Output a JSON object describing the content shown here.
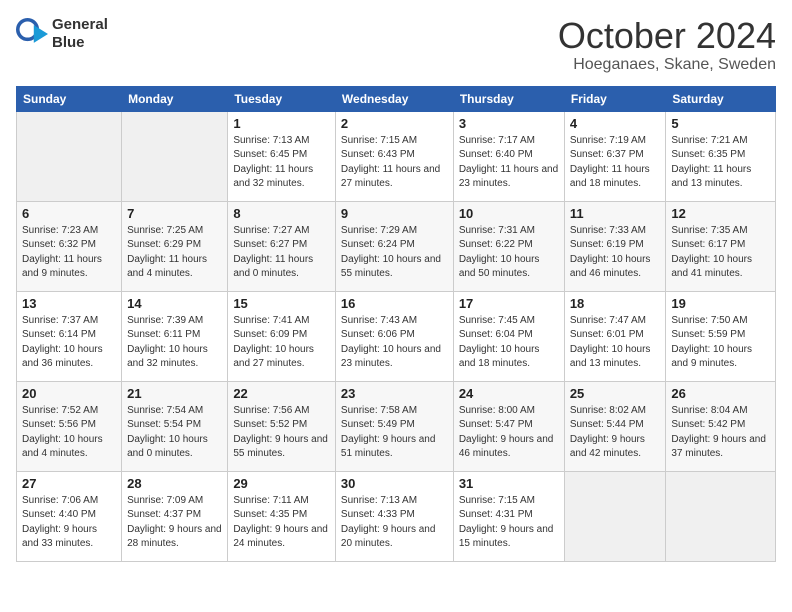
{
  "logo": {
    "line1": "General",
    "line2": "Blue"
  },
  "title": "October 2024",
  "location": "Hoeganaes, Skane, Sweden",
  "weekdays": [
    "Sunday",
    "Monday",
    "Tuesday",
    "Wednesday",
    "Thursday",
    "Friday",
    "Saturday"
  ],
  "weeks": [
    [
      {
        "day": "",
        "empty": true
      },
      {
        "day": "",
        "empty": true
      },
      {
        "day": "1",
        "sunrise": "Sunrise: 7:13 AM",
        "sunset": "Sunset: 6:45 PM",
        "daylight": "Daylight: 11 hours and 32 minutes."
      },
      {
        "day": "2",
        "sunrise": "Sunrise: 7:15 AM",
        "sunset": "Sunset: 6:43 PM",
        "daylight": "Daylight: 11 hours and 27 minutes."
      },
      {
        "day": "3",
        "sunrise": "Sunrise: 7:17 AM",
        "sunset": "Sunset: 6:40 PM",
        "daylight": "Daylight: 11 hours and 23 minutes."
      },
      {
        "day": "4",
        "sunrise": "Sunrise: 7:19 AM",
        "sunset": "Sunset: 6:37 PM",
        "daylight": "Daylight: 11 hours and 18 minutes."
      },
      {
        "day": "5",
        "sunrise": "Sunrise: 7:21 AM",
        "sunset": "Sunset: 6:35 PM",
        "daylight": "Daylight: 11 hours and 13 minutes."
      }
    ],
    [
      {
        "day": "6",
        "sunrise": "Sunrise: 7:23 AM",
        "sunset": "Sunset: 6:32 PM",
        "daylight": "Daylight: 11 hours and 9 minutes."
      },
      {
        "day": "7",
        "sunrise": "Sunrise: 7:25 AM",
        "sunset": "Sunset: 6:29 PM",
        "daylight": "Daylight: 11 hours and 4 minutes."
      },
      {
        "day": "8",
        "sunrise": "Sunrise: 7:27 AM",
        "sunset": "Sunset: 6:27 PM",
        "daylight": "Daylight: 11 hours and 0 minutes."
      },
      {
        "day": "9",
        "sunrise": "Sunrise: 7:29 AM",
        "sunset": "Sunset: 6:24 PM",
        "daylight": "Daylight: 10 hours and 55 minutes."
      },
      {
        "day": "10",
        "sunrise": "Sunrise: 7:31 AM",
        "sunset": "Sunset: 6:22 PM",
        "daylight": "Daylight: 10 hours and 50 minutes."
      },
      {
        "day": "11",
        "sunrise": "Sunrise: 7:33 AM",
        "sunset": "Sunset: 6:19 PM",
        "daylight": "Daylight: 10 hours and 46 minutes."
      },
      {
        "day": "12",
        "sunrise": "Sunrise: 7:35 AM",
        "sunset": "Sunset: 6:17 PM",
        "daylight": "Daylight: 10 hours and 41 minutes."
      }
    ],
    [
      {
        "day": "13",
        "sunrise": "Sunrise: 7:37 AM",
        "sunset": "Sunset: 6:14 PM",
        "daylight": "Daylight: 10 hours and 36 minutes."
      },
      {
        "day": "14",
        "sunrise": "Sunrise: 7:39 AM",
        "sunset": "Sunset: 6:11 PM",
        "daylight": "Daylight: 10 hours and 32 minutes."
      },
      {
        "day": "15",
        "sunrise": "Sunrise: 7:41 AM",
        "sunset": "Sunset: 6:09 PM",
        "daylight": "Daylight: 10 hours and 27 minutes."
      },
      {
        "day": "16",
        "sunrise": "Sunrise: 7:43 AM",
        "sunset": "Sunset: 6:06 PM",
        "daylight": "Daylight: 10 hours and 23 minutes."
      },
      {
        "day": "17",
        "sunrise": "Sunrise: 7:45 AM",
        "sunset": "Sunset: 6:04 PM",
        "daylight": "Daylight: 10 hours and 18 minutes."
      },
      {
        "day": "18",
        "sunrise": "Sunrise: 7:47 AM",
        "sunset": "Sunset: 6:01 PM",
        "daylight": "Daylight: 10 hours and 13 minutes."
      },
      {
        "day": "19",
        "sunrise": "Sunrise: 7:50 AM",
        "sunset": "Sunset: 5:59 PM",
        "daylight": "Daylight: 10 hours and 9 minutes."
      }
    ],
    [
      {
        "day": "20",
        "sunrise": "Sunrise: 7:52 AM",
        "sunset": "Sunset: 5:56 PM",
        "daylight": "Daylight: 10 hours and 4 minutes."
      },
      {
        "day": "21",
        "sunrise": "Sunrise: 7:54 AM",
        "sunset": "Sunset: 5:54 PM",
        "daylight": "Daylight: 10 hours and 0 minutes."
      },
      {
        "day": "22",
        "sunrise": "Sunrise: 7:56 AM",
        "sunset": "Sunset: 5:52 PM",
        "daylight": "Daylight: 9 hours and 55 minutes."
      },
      {
        "day": "23",
        "sunrise": "Sunrise: 7:58 AM",
        "sunset": "Sunset: 5:49 PM",
        "daylight": "Daylight: 9 hours and 51 minutes."
      },
      {
        "day": "24",
        "sunrise": "Sunrise: 8:00 AM",
        "sunset": "Sunset: 5:47 PM",
        "daylight": "Daylight: 9 hours and 46 minutes."
      },
      {
        "day": "25",
        "sunrise": "Sunrise: 8:02 AM",
        "sunset": "Sunset: 5:44 PM",
        "daylight": "Daylight: 9 hours and 42 minutes."
      },
      {
        "day": "26",
        "sunrise": "Sunrise: 8:04 AM",
        "sunset": "Sunset: 5:42 PM",
        "daylight": "Daylight: 9 hours and 37 minutes."
      }
    ],
    [
      {
        "day": "27",
        "sunrise": "Sunrise: 7:06 AM",
        "sunset": "Sunset: 4:40 PM",
        "daylight": "Daylight: 9 hours and 33 minutes."
      },
      {
        "day": "28",
        "sunrise": "Sunrise: 7:09 AM",
        "sunset": "Sunset: 4:37 PM",
        "daylight": "Daylight: 9 hours and 28 minutes."
      },
      {
        "day": "29",
        "sunrise": "Sunrise: 7:11 AM",
        "sunset": "Sunset: 4:35 PM",
        "daylight": "Daylight: 9 hours and 24 minutes."
      },
      {
        "day": "30",
        "sunrise": "Sunrise: 7:13 AM",
        "sunset": "Sunset: 4:33 PM",
        "daylight": "Daylight: 9 hours and 20 minutes."
      },
      {
        "day": "31",
        "sunrise": "Sunrise: 7:15 AM",
        "sunset": "Sunset: 4:31 PM",
        "daylight": "Daylight: 9 hours and 15 minutes."
      },
      {
        "day": "",
        "empty": true
      },
      {
        "day": "",
        "empty": true
      }
    ]
  ]
}
